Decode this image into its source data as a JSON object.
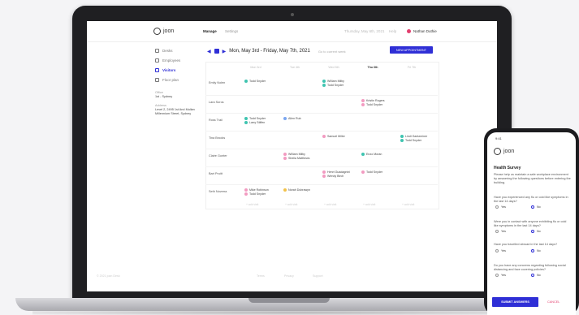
{
  "app": {
    "logo": "joon",
    "nav": [
      "Manage",
      "Settings"
    ],
    "header_right": [
      "Thursday, May 6th, 2021",
      "Help"
    ],
    "user": "Nathan Duthie"
  },
  "sidebar": {
    "items": [
      "Desks",
      "Employees",
      "Visitors",
      "Floor plan"
    ],
    "office_label": "Office",
    "office_value": "1st - Sydney",
    "address_label": "Address",
    "address_value": "Level 2, 2495 1st And Mullan Millennium Street, Sydney"
  },
  "calendar": {
    "range": "Mon, May 3rd - Friday, May 7th, 2021",
    "today": "Go to current week",
    "new_button": "NEW APPOINTMENT",
    "days": [
      "Mon 3rd",
      "Tue 4th",
      "Wed 5th",
      "Thu 6th",
      "Fri 7th"
    ],
    "highlighted_day": 3,
    "rows": [
      "Emily Nolen",
      "Lara Soros",
      "Ross Trail",
      "Tina Brooks",
      "Claire Gunter",
      "Bart Pruitt",
      "Seth Noverra"
    ],
    "events": [
      {
        "row": 0,
        "day": 0,
        "lines": [
          "Todd Snyder"
        ],
        "color": "#3fc4b0"
      },
      {
        "row": 0,
        "day": 2,
        "lines": [
          "William Milby",
          "Todd Snyder"
        ],
        "color": "#3fc4b0"
      },
      {
        "row": 1,
        "day": 3,
        "lines": [
          "Kristin Rogers",
          "Todd Snyder"
        ],
        "color": "#f29bc1"
      },
      {
        "row": 2,
        "day": 0,
        "lines": [
          "Todd Snyder",
          "Larry Stiffen"
        ],
        "color": "#3fc4b0"
      },
      {
        "row": 2,
        "day": 1,
        "lines": [
          "Allen Rub"
        ],
        "color": "#7aa6f0"
      },
      {
        "row": 3,
        "day": 2,
        "lines": [
          "Samuel Miller"
        ],
        "color": "#f29bc1"
      },
      {
        "row": 3,
        "day": 4,
        "lines": [
          "Lindi Gantzminer",
          "Todd Snyder"
        ],
        "color": "#3fc4b0"
      },
      {
        "row": 4,
        "day": 1,
        "lines": [
          "William Milby",
          "Sheila Matthews"
        ],
        "color": "#f29bc1"
      },
      {
        "row": 4,
        "day": 3,
        "lines": [
          "Enzo Moran"
        ],
        "color": "#3fc4b0"
      },
      {
        "row": 5,
        "day": 2,
        "lines": [
          "Henri Guadagnini",
          "Wendy Birch"
        ],
        "color": "#f29bc1"
      },
      {
        "row": 5,
        "day": 3,
        "lines": [
          "Todd Snyder"
        ],
        "color": "#f29bc1"
      },
      {
        "row": 6,
        "day": 0,
        "lines": [
          "Mike Robinson",
          "Todd Snyder"
        ],
        "color": "#f29bc1"
      },
      {
        "row": 6,
        "day": 1,
        "lines": [
          "Norah Dubrawyn"
        ],
        "color": "#f2c24a"
      }
    ],
    "footer": [
      "+ add visit",
      "+ add visit",
      "+ add visit",
      "+ add visit",
      "+ add visit"
    ]
  },
  "screen_footer": [
    "© 2021 joon Desk",
    "Terms",
    "Privacy",
    "Support"
  ],
  "phone": {
    "time": "9:41",
    "logo": "joon",
    "title": "Health Survey",
    "intro": "Please help us maintain a safe workplace environment by answering the following questions before entering the building.",
    "questions": [
      {
        "text": "Have you experienced any flu or cold like symptoms in the last 14 days?",
        "yes": "Yes",
        "no": "No",
        "selected": "no"
      },
      {
        "text": "Were you in contact with anyone exhibiting flu or cold like symptoms in the last 14 days?",
        "yes": "Yes",
        "no": "No",
        "selected": "no"
      },
      {
        "text": "Have you travelled abroad in the last 14 days?",
        "yes": "Yes",
        "no": "No",
        "selected": "no"
      },
      {
        "text": "Do you have any concerns regarding following social distancing and face covering policies?",
        "yes": "Yes",
        "no": "No",
        "selected": "no"
      }
    ],
    "submit": "SUBMIT ANSWERS",
    "cancel": "CANCEL"
  }
}
